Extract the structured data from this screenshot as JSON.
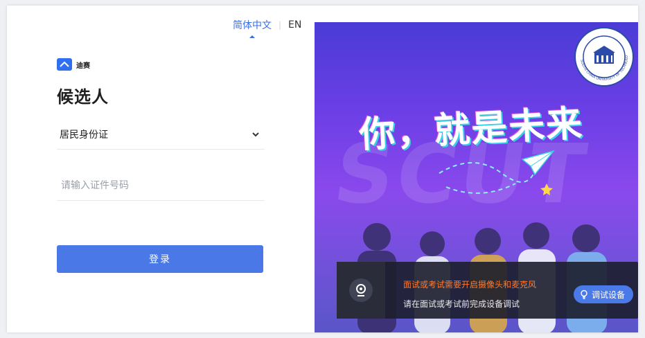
{
  "language": {
    "chinese": "简体中文",
    "separator": "|",
    "english": "EN"
  },
  "brand": {
    "text": "迪赛"
  },
  "page_title": "候选人",
  "form": {
    "id_type": "居民身份证",
    "id_number_placeholder": "请输入证件号码",
    "id_number_value": "",
    "login_label": "登录"
  },
  "poster": {
    "slogan": "你，就是未来",
    "watermark": "SCUT",
    "emblem_text": "SOUTH CHINA UNIVERSITY OF TECHNOLOGY"
  },
  "notice": {
    "warning": "面试或考试需要开启摄像头和麦克风",
    "sub": "请在面试或考试前完成设备调试",
    "test_button": "调试设备"
  },
  "colors": {
    "accent": "#3b6ee8",
    "button": "#4a78e6",
    "warning": "#ff7a2e",
    "poster_top": "#4a3bd6",
    "poster_mid": "#8a49ec"
  },
  "icons": [
    "brand-logo-icon",
    "chevron-down-icon",
    "university-emblem-icon",
    "paper-plane-icon",
    "webcam-icon",
    "lightbulb-icon"
  ]
}
